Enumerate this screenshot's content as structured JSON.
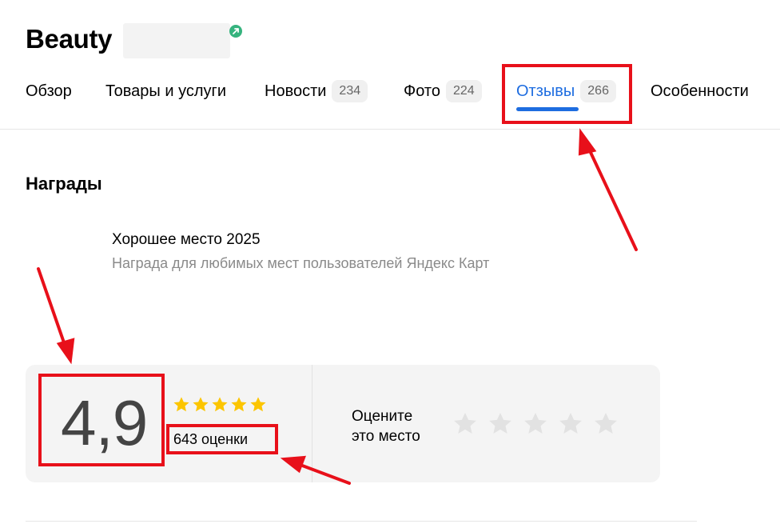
{
  "header": {
    "title": "Beauty"
  },
  "tabs": [
    {
      "label": "Обзор"
    },
    {
      "label": "Товары и услуги"
    },
    {
      "label": "Новости",
      "count": "234"
    },
    {
      "label": "Фото",
      "count": "224"
    },
    {
      "label": "Отзывы",
      "count": "266",
      "active": true
    },
    {
      "label": "Особенности"
    }
  ],
  "awards": {
    "heading": "Награды",
    "items": [
      {
        "title": "Хорошее место 2025",
        "description": "Награда для любимых мест пользователей Яндекс Карт"
      }
    ]
  },
  "rating": {
    "value": "4,9",
    "stars_filled": 5,
    "stars_total": 5,
    "count_label": "643 оценки",
    "rate_prompt_line1": "Оцените",
    "rate_prompt_line2": "это место",
    "rate_stars_total": 5
  },
  "colors": {
    "accent": "#1e6de0",
    "star_filled": "#fcc500",
    "star_empty": "#e2e2e2",
    "annotation": "#e8101a",
    "verified": "#36b37e"
  }
}
